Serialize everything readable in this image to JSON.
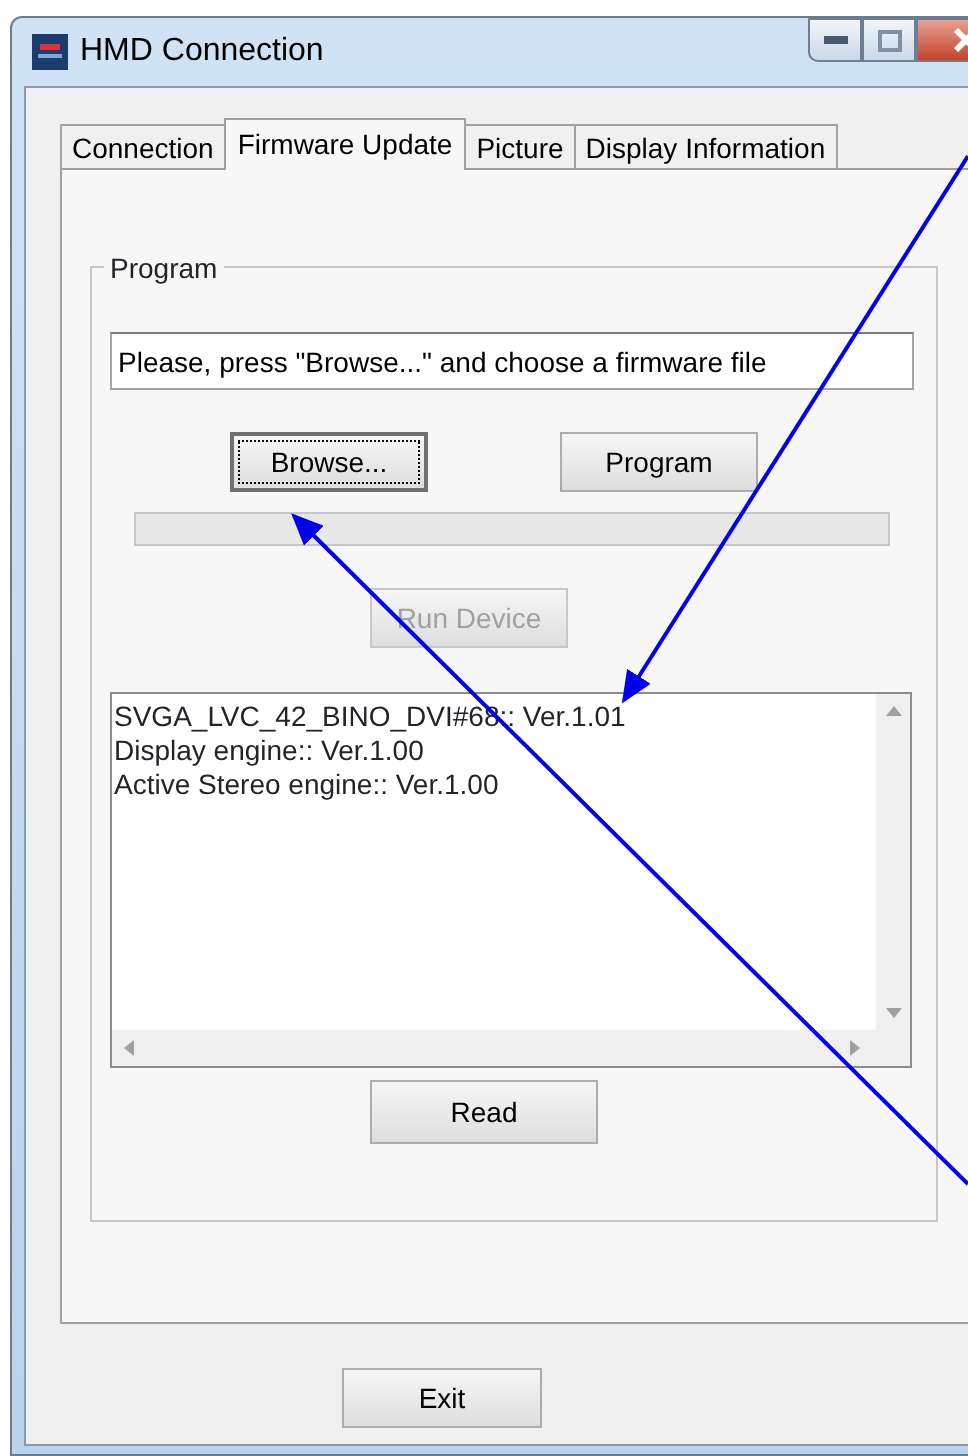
{
  "window": {
    "title": "HMD Connection"
  },
  "tabs": [
    {
      "label": "Connection",
      "selected": false
    },
    {
      "label": "Firmware Update",
      "selected": true
    },
    {
      "label": "Picture",
      "selected": false
    },
    {
      "label": "Display Information",
      "selected": false
    }
  ],
  "program_group": {
    "title": "Program",
    "file_field": {
      "value": "Please, press \"Browse...\" and choose a firmware file"
    },
    "buttons": [
      {
        "label": "Browse...",
        "focused": true,
        "disabled": false
      },
      {
        "label": "Program",
        "focused": false,
        "disabled": false
      }
    ],
    "progress": {
      "level": 0
    },
    "run_button": {
      "label": "Run Device",
      "disabled": true
    },
    "log_lines": [
      "SVGA_LVC_42_BINO_DVI#68:: Ver.1.01",
      "Display engine:: Ver.1.00",
      "Active Stereo engine:: Ver.1.00"
    ],
    "read_button": {
      "label": "Read",
      "disabled": false
    }
  },
  "exit_button": {
    "label": "Exit",
    "disabled": false
  }
}
